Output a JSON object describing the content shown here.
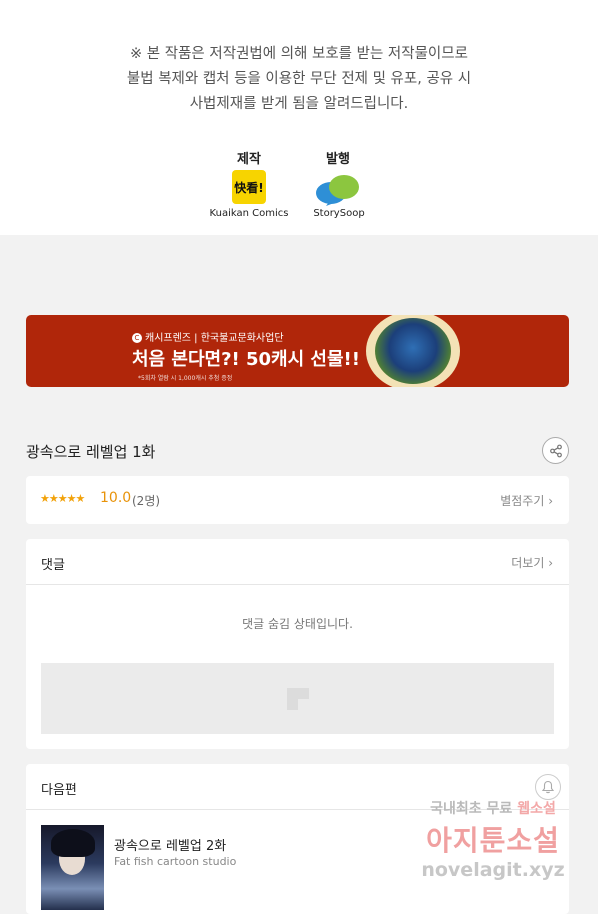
{
  "notice": {
    "line1": "※ 본 작품은 저작권법에 의해 보호를 받는 저작물이므로",
    "line2": "불법 복제와 캡처 등을  이용한 무단 전제 및 유포, 공유 시",
    "line3": "사법제재를  받게 됨을 알려드립니다."
  },
  "credits": {
    "production_label": "제작",
    "publisher_label": "발행",
    "production_logo_text": "快看!",
    "production_name": "Kuaikan Comics",
    "publisher_name": "StorySoop"
  },
  "banner": {
    "sub_text": "캐시프렌즈 | 한국불교문화사업단",
    "main_text": "처음 본다면?! 50캐시 선물!!",
    "fine_print": "*5회차 열람 시 1,000캐시 추첨 증정",
    "art_icon": "dragon-plate-art"
  },
  "episode": {
    "title": "광속으로 레벨업 1화",
    "share_icon": "share-icon"
  },
  "rating": {
    "stars": "★★★★★",
    "score": "10.0",
    "count": "(2명)",
    "rate_button": "별점주기 ›"
  },
  "comments": {
    "header": "댓글",
    "more": "더보기 ›",
    "hidden_message": "댓글 숨김 상태입니다."
  },
  "next_episode": {
    "header": "다음편",
    "title": "광속으로 레벨업 2화",
    "studio": "Fat fish cartoon studio"
  },
  "watermark": {
    "line1_prefix": "국내최초 무료 ",
    "line1_highlight": "웹소설",
    "line2": "아지툰소설",
    "line3": "novelagit.xyz"
  },
  "colors": {
    "banner_bg": "#b0260a",
    "rating_accent": "#e8930a",
    "page_bg": "#f2f2f2"
  }
}
